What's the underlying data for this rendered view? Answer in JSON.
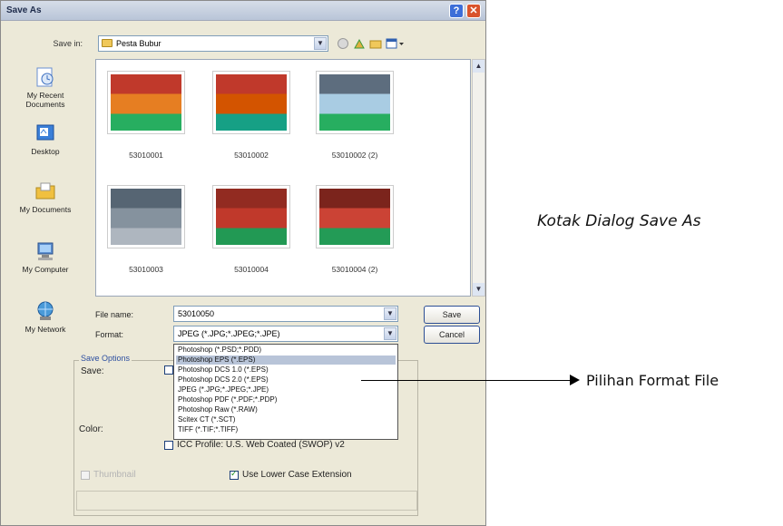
{
  "window": {
    "title": "Save As",
    "help_label": "?",
    "close_label": "✕"
  },
  "save_in": {
    "label": "Save in:",
    "value": "Pesta Bubur"
  },
  "places": [
    {
      "label": "My Recent Documents",
      "icon": "recent-documents-icon",
      "color": "#6a8fd0"
    },
    {
      "label": "Desktop",
      "icon": "desktop-icon",
      "color": "#3a7fd8"
    },
    {
      "label": "My Documents",
      "icon": "my-documents-icon",
      "color": "#f0c040"
    },
    {
      "label": "My Computer",
      "icon": "my-computer-icon",
      "color": "#5c8fd0"
    },
    {
      "label": "My Network",
      "icon": "my-network-icon",
      "color": "#4a9ad8"
    }
  ],
  "files": [
    {
      "name": "53010001",
      "colors": [
        "#c0392b",
        "#e67e22",
        "#27ae60"
      ]
    },
    {
      "name": "53010002",
      "colors": [
        "#c0392b",
        "#d35400",
        "#16a085"
      ]
    },
    {
      "name": "53010002 (2)",
      "colors": [
        "#5d6d7e",
        "#a9cce3",
        "#27ae60"
      ]
    },
    {
      "name": "53010003",
      "colors": [
        "#566573",
        "#85929e",
        "#aeb6bf"
      ]
    },
    {
      "name": "53010004",
      "colors": [
        "#922b21",
        "#c0392b",
        "#229954"
      ]
    },
    {
      "name": "53010004 (2)",
      "colors": [
        "#7b241c",
        "#cb4335",
        "#239b56"
      ]
    }
  ],
  "form": {
    "file_name_label": "File name:",
    "file_name_value": "53010050",
    "format_label": "Format:",
    "format_value": "JPEG (*.JPG;*.JPEG;*.JPE)",
    "save_button": "Save",
    "cancel_button": "Cancel"
  },
  "format_options": [
    {
      "label": "Photoshop (*.PSD;*.PDD)",
      "selected": false
    },
    {
      "label": "Photoshop EPS (*.EPS)",
      "selected": true
    },
    {
      "label": "Photoshop DCS 1.0 (*.EPS)",
      "selected": false
    },
    {
      "label": "Photoshop DCS 2.0 (*.EPS)",
      "selected": false
    },
    {
      "label": "JPEG (*.JPG;*.JPEG;*.JPE)",
      "selected": false
    },
    {
      "label": "Photoshop PDF (*.PDF;*.PDP)",
      "selected": false
    },
    {
      "label": "Photoshop Raw (*.RAW)",
      "selected": false
    },
    {
      "label": "Scitex CT (*.SCT)",
      "selected": false
    },
    {
      "label": "TIFF (*.TIF;*.TIFF)",
      "selected": false
    }
  ],
  "save_options": {
    "legend": "Save Options",
    "save_label": "Save:",
    "color_label": "Color:",
    "icc_profile_label": "ICC Profile:  U.S. Web Coated (SWOP) v2",
    "thumbnail_label": "Thumbnail",
    "lowercase_label": "Use Lower Case Extension"
  },
  "annotations": {
    "caption": "Kotak Dialog Save As",
    "arrow_label": "Pilihan Format File"
  }
}
